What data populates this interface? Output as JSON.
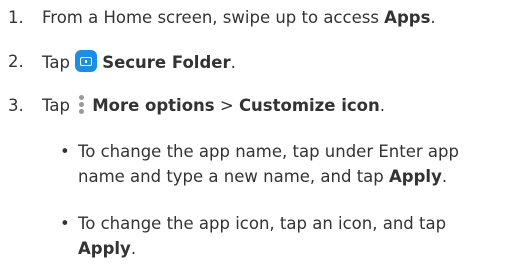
{
  "steps": [
    {
      "number": "1.",
      "pre": "From a Home screen, swipe up to access ",
      "bold": "Apps",
      "post": "."
    },
    {
      "number": "2.",
      "pre": "Tap ",
      "icon": "secure-folder-icon",
      "bold": "Secure Folder",
      "post": "."
    },
    {
      "number": "3.",
      "pre": "Tap ",
      "icon": "more-options-icon",
      "bold1": "More options",
      "sep": " > ",
      "bold2": "Customize icon",
      "post": "."
    }
  ],
  "bullets": [
    {
      "marker": "•",
      "line1": "To change the app name, tap under Enter app",
      "line2_pre": "name and type a new name, and tap ",
      "bold": "Apply",
      "post": "."
    },
    {
      "marker": "•",
      "line1": "To change the app icon, tap an icon, and tap",
      "bold": "Apply",
      "post": "."
    }
  ],
  "colors": {
    "text": "#333333",
    "secure_folder_icon": "#1a8fe3",
    "more_options_icon": "#9a9a9a"
  }
}
